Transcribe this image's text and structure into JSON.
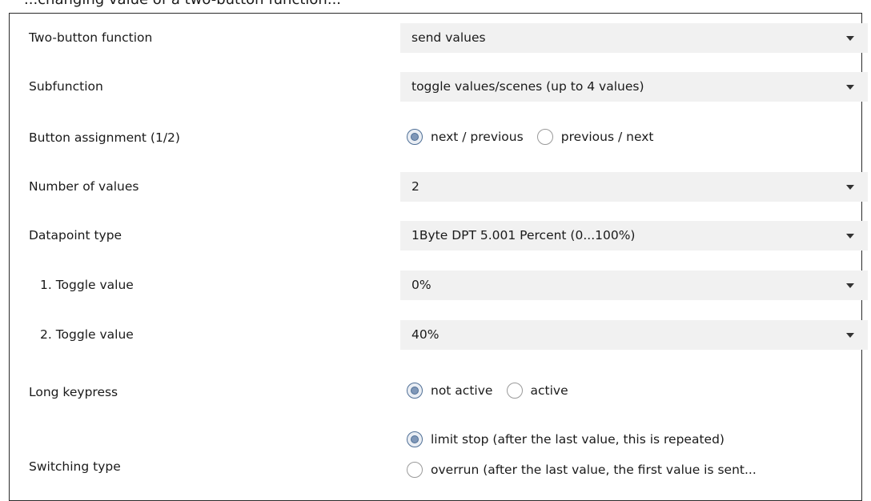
{
  "caption": "...changing value of a two-button function...",
  "rows": [
    {
      "label": "Two-button function",
      "value": "send values"
    },
    {
      "label": "Subfunction",
      "value": "toggle values/scenes (up to 4 values)"
    },
    {
      "label": "Button assignment (1/2)",
      "options": [
        "next / previous",
        "previous / next"
      ],
      "selected": 0
    },
    {
      "label": "Number of values",
      "value": "2"
    },
    {
      "label": "Datapoint type",
      "value": "1Byte DPT 5.001 Percent (0...100%)"
    },
    {
      "label": "1. Toggle value",
      "value": "0%"
    },
    {
      "label": "2. Toggle value",
      "value": "40%"
    },
    {
      "label": "Long keypress",
      "options": [
        "not active",
        "active"
      ],
      "selected": 0
    },
    {
      "label": "Switching type",
      "options": [
        "limit stop (after the last value, this is repeated)",
        "overrun (after the last value, the first value is sent..."
      ],
      "selected": 0
    }
  ],
  "icons": {
    "dropdown_arrow": "chevron-down-icon",
    "radio": "radio-button-icon"
  }
}
